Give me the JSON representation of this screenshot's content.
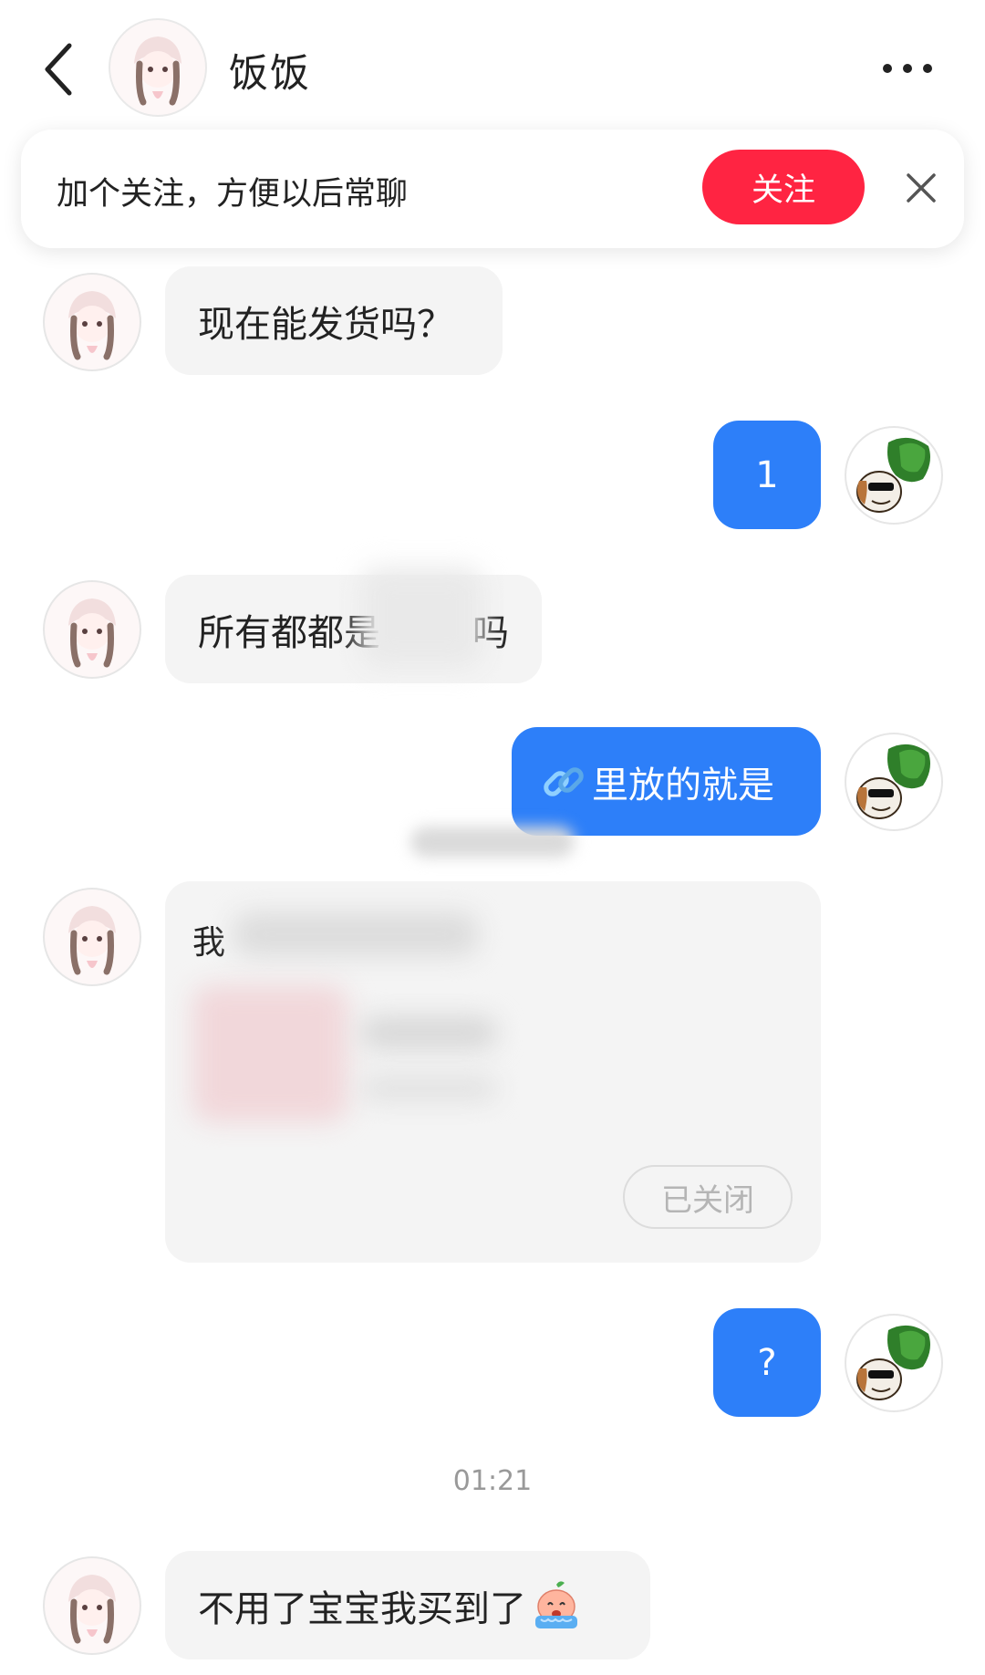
{
  "header": {
    "title": "饭饭",
    "back_icon": "chevron-left-icon",
    "more_icon": "more-horizontal-icon"
  },
  "banner": {
    "text": "加个关注，方便以后常聊",
    "follow_label": "关注",
    "close_icon": "close-icon"
  },
  "messages": [
    {
      "side": "in",
      "text": "现在能发货吗？"
    },
    {
      "side": "out",
      "text": "1"
    },
    {
      "side": "in",
      "text_start": "所有都都是",
      "text_end": "吗"
    },
    {
      "side": "out",
      "link_icon": "link-icon",
      "text": "里放的就是"
    },
    {
      "side": "in",
      "text_start": "我",
      "status": "已关闭"
    },
    {
      "side": "out",
      "text": "?"
    },
    {
      "side": "in",
      "text": "不用了宝宝我买到了",
      "emoji": "crying-peach-emoji"
    }
  ],
  "timestamp": "01:21",
  "colors": {
    "accent_red": "#ff2442",
    "bubble_blue": "#2d7ff9",
    "bubble_gray": "#f4f4f4"
  }
}
